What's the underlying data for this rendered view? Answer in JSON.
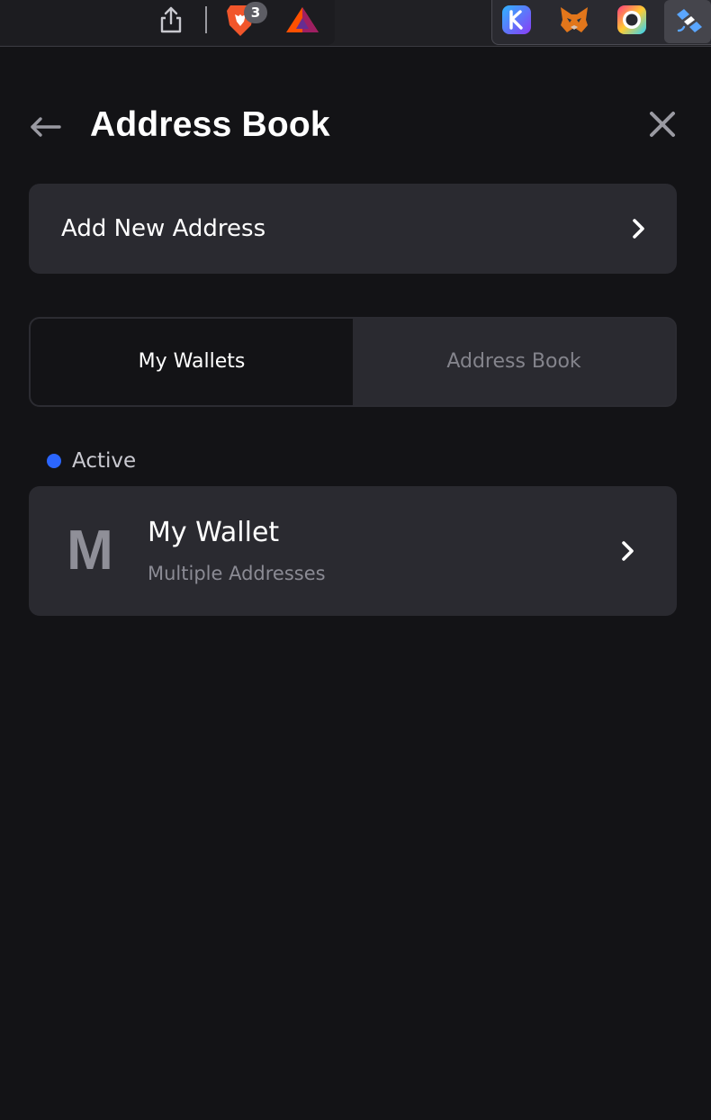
{
  "toolbar": {
    "icons": [
      "share-icon",
      "brave-shields-icon",
      "bat-rewards-icon",
      "keplr-icon",
      "metamask-fox-icon",
      "circle-extension-icon",
      "satellite-extension-icon"
    ],
    "brave_badge": "3"
  },
  "header": {
    "title": "Address Book",
    "back_icon": "arrow-left-icon",
    "close_icon": "close-icon"
  },
  "add_address": {
    "label": "Add New Address",
    "icon": "chevron-right-icon"
  },
  "tabs": [
    {
      "label": "My Wallets",
      "selected": true
    },
    {
      "label": "Address Book",
      "selected": false
    }
  ],
  "active_section": {
    "label": "Active",
    "dot_color": "#2b66ff"
  },
  "wallet": {
    "avatar_letter": "M",
    "name": "My Wallet",
    "subtitle": "Multiple Addresses",
    "icon": "chevron-right-icon"
  },
  "colors": {
    "background": "#131316",
    "card": "#2a2a30",
    "text_primary": "#ffffff",
    "text_secondary": "#8b8b94",
    "accent": "#2b66ff"
  }
}
